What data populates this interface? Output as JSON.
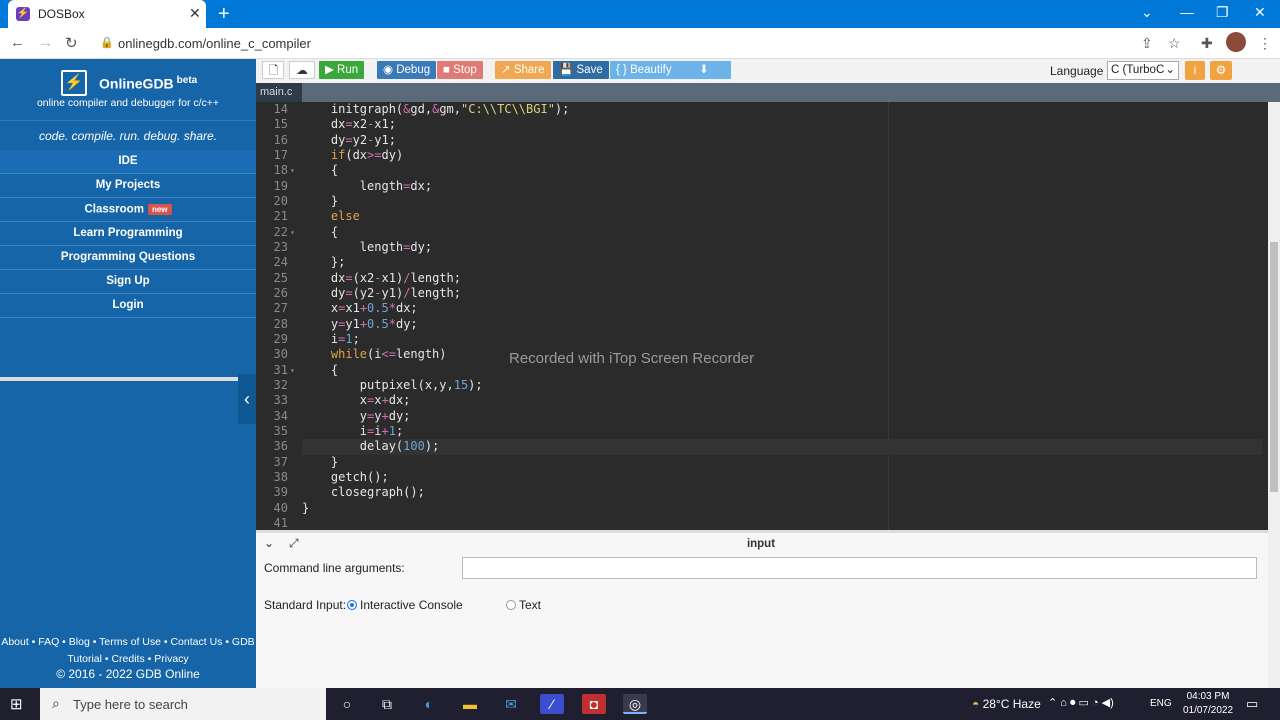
{
  "browser": {
    "tab_title": "DOSBox",
    "url": "onlinegdb.com/online_c_compiler"
  },
  "sidebar": {
    "logo_name": "OnlineGDB",
    "logo_beta": "beta",
    "logo_sub": "online compiler and debugger for c/c++",
    "tagline": "code. compile. run. debug. share.",
    "items": [
      {
        "label": "IDE"
      },
      {
        "label": "My Projects"
      },
      {
        "label": "Classroom",
        "badge": "new"
      },
      {
        "label": "Learn Programming"
      },
      {
        "label": "Programming Questions"
      },
      {
        "label": "Sign Up"
      },
      {
        "label": "Login"
      }
    ],
    "footer_line1": "About • FAQ • Blog • Terms of Use • Contact Us • GDB",
    "footer_line2": "Tutorial • Credits • Privacy",
    "copyright": "© 2016 - 2022 GDB Online"
  },
  "toolbar": {
    "run": "Run",
    "debug": "Debug",
    "stop": "Stop",
    "share": "Share",
    "save": "Save",
    "beautify": "{ } Beautify",
    "language_label": "Language",
    "language_value": "C (TurboC"
  },
  "editor": {
    "file_tab": "main.c",
    "watermark": "Recorded with iTop Screen Recorder",
    "current_line": 36
  },
  "input_panel": {
    "title": "input",
    "cmd_label": "Command line arguments:",
    "cmd_value": "",
    "stdin_label": "Standard Input:",
    "option_console": "Interactive Console",
    "option_text": "Text",
    "selected": "Interactive Console"
  },
  "taskbar": {
    "search_placeholder": "Type here to search",
    "weather": "28°C  Haze",
    "lang": "ENG",
    "time": "04:03 PM",
    "date": "01/07/2022"
  }
}
